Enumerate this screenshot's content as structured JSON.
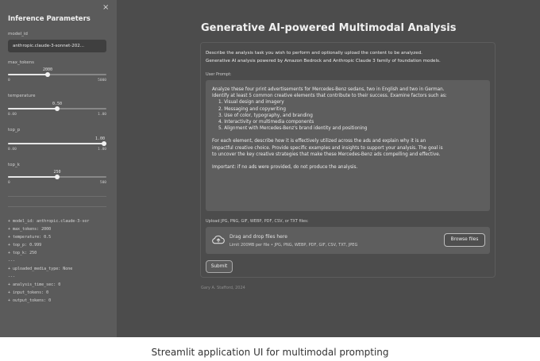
{
  "sidebar": {
    "close_icon": "×",
    "title": "Inference Parameters",
    "model_label": "model_id",
    "model_value": "anthropic.claude-3-sonnet-202...",
    "sliders": [
      {
        "label": "max_tokens",
        "value": "2000",
        "min": "0",
        "max": "5000",
        "fraction": 0.4
      },
      {
        "label": "temperature",
        "value": "0.50",
        "min": "0.00",
        "max": "1.00",
        "fraction": 0.5
      },
      {
        "label": "top_p",
        "value": "1.00",
        "min": "0.00",
        "max": "1.00",
        "fraction": 1.0
      },
      {
        "label": "top_k",
        "value": "250",
        "min": "0",
        "max": "500",
        "fraction": 0.5
      }
    ],
    "log": [
      "+ model_id: anthropic.claude-3-sor",
      "+ max_tokens: 2000",
      "+ temperature: 0.5",
      "+ top_p: 0.999",
      "+ top_k: 250",
      "---",
      "+ uploaded_media_type: None",
      "---",
      "+ analysis_time_sec: 0",
      "+ input_tokens: 0",
      "+ output_tokens: 0"
    ]
  },
  "main": {
    "title": "Generative AI-powered Multimodal Analysis",
    "description_line1": "Describe the analysis task you wish to perform and optionally upload the content to be analyzed.",
    "description_line2": "Generative AI analysis powered by Amazon Bedrock and Anthropic Claude 3 family of foundation models.",
    "prompt_label": "User Prompt:",
    "prompt_lines": [
      "Analyze these four print advertisements for Mercedes-Benz sedans, two in English and two in German.",
      "Identify at least 5 common creative elements that contribute to their success. Examine factors such as:"
    ],
    "prompt_list": [
      "1. Visual design and imagery",
      "2. Messaging and copywriting",
      "3. Use of color, typography, and branding",
      "4. Interactivity or multimedia components",
      "5. Alignment with Mercedes-Benz's brand identity and positioning"
    ],
    "prompt_para2": [
      "For each element, describe how it is effectively utilized across the ads and explain why it is an",
      "impactful creative choice. Provide specific examples and insights to support your analysis. The goal is",
      "to uncover the key creative strategies that make these Mercedes-Benz ads compelling and effective."
    ],
    "prompt_para3": "Important: if no ads were provided, do not produce the analysis.",
    "upload_label": "Upload JPG, PNG, GIF, WEBP, PDF, CSV, or TXT files:",
    "dropzone_main": "Drag and drop files here",
    "dropzone_sub": "Limit 200MB per file • JPG, PNG, WEBP, PDF, GIF, CSV, TXT, JPEG",
    "upload_icon": "cloud-upload-icon",
    "browse_label": "Browse files",
    "submit_label": "Submit",
    "footer": "Gary A. Stafford, 2024"
  },
  "caption": "Streamlit application UI for multimodal prompting"
}
